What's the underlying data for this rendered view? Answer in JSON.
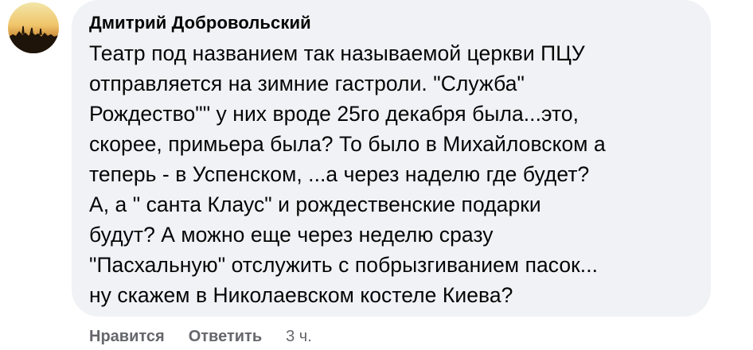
{
  "comment": {
    "author": "Дмитрий Добровольский",
    "text": "Театр под названием так называемой церкви ПЦУ\nотправляется на зимние гастроли. \"Служба\"\nРождество\"\" у них вроде 25го декабря была...это,\nскорее, примьера была? То было в Михайловском а\nтеперь - в Успенском, ...а через наделю где будет?\nА, а \" санта Клаус\" и рождественские подарки\nбудут? А можно еще через неделю сразу\n\"Пасхальную\" отслужить с побрызгиванием пасок...\nну скажем в Николаевском костеле Киева?",
    "avatar_icon": "profile-photo-sunset"
  },
  "actions": {
    "like_label": "Нравится",
    "reply_label": "Ответить",
    "timestamp": "3 ч."
  },
  "colors": {
    "bubble": "#f0f2f5",
    "text": "#050505",
    "secondary": "#65676b"
  }
}
